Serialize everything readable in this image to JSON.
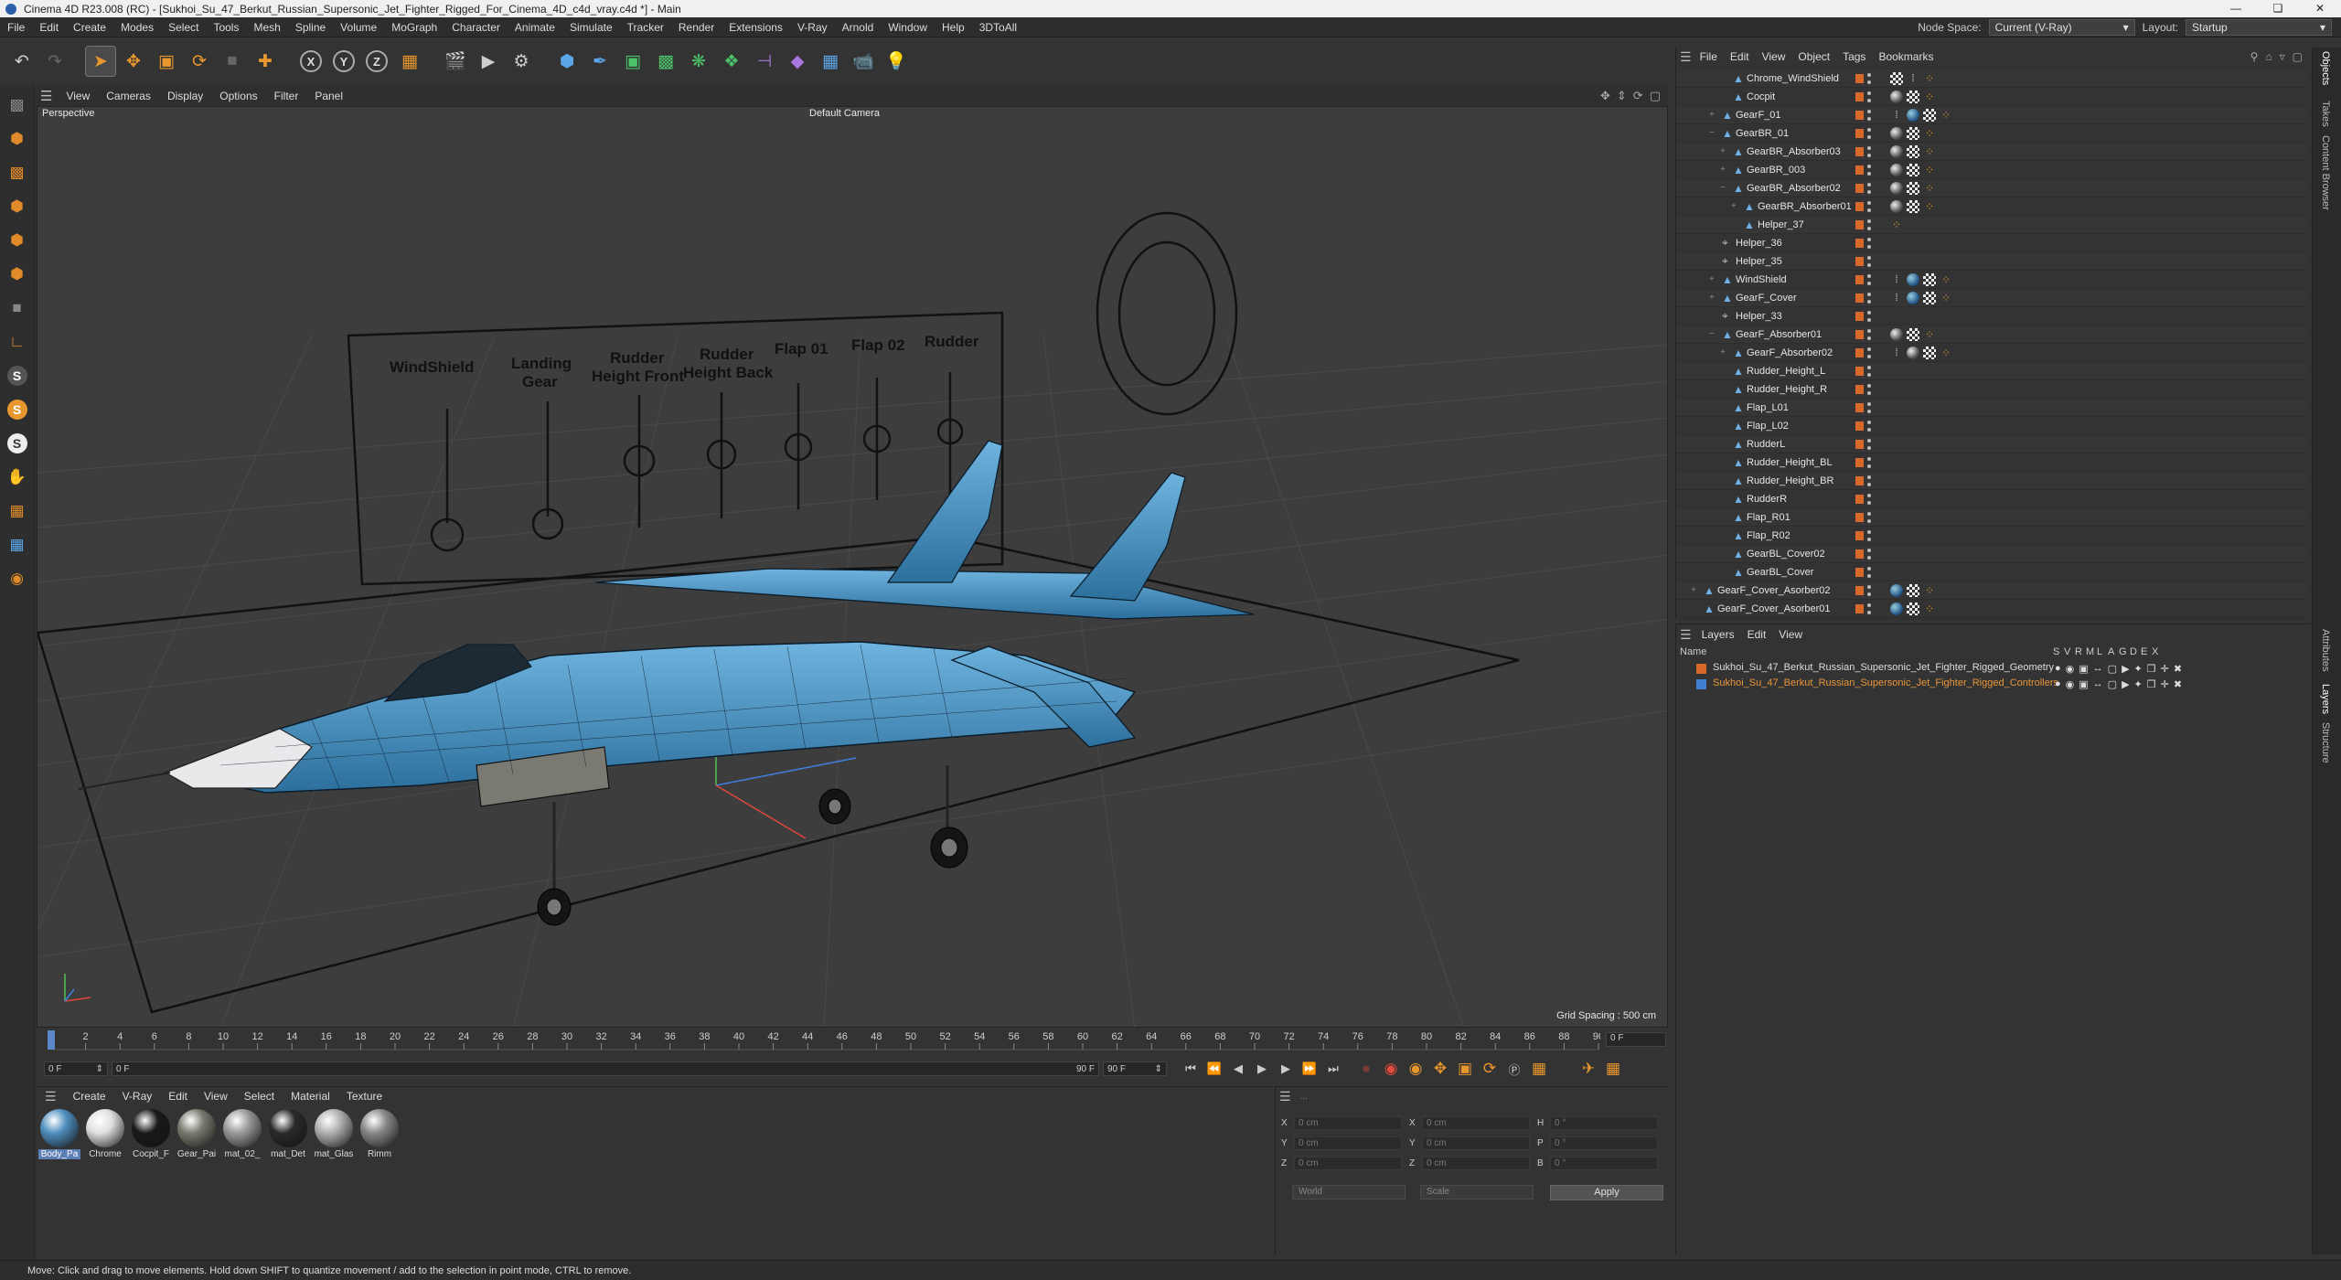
{
  "window": {
    "title": "Cinema 4D R23.008 (RC) - [Sukhoi_Su_47_Berkut_Russian_Supersonic_Jet_Fighter_Rigged_For_Cinema_4D_c4d_vray.c4d *] - Main",
    "minimize": "—",
    "maximize": "❏",
    "close": "✕"
  },
  "menubar": {
    "items": [
      "File",
      "Edit",
      "Create",
      "Modes",
      "Select",
      "Tools",
      "Mesh",
      "Spline",
      "Volume",
      "MoGraph",
      "Character",
      "Animate",
      "Simulate",
      "Tracker",
      "Render",
      "Extensions",
      "V-Ray",
      "Arnold",
      "Window",
      "Help",
      "3DToAll"
    ],
    "node_space_label": "Node Space:",
    "node_space_value": "Current (V-Ray)",
    "layout_label": "Layout:",
    "layout_value": "Startup"
  },
  "viewport": {
    "menu": [
      "View",
      "Cameras",
      "Display",
      "Options",
      "Filter",
      "Panel"
    ],
    "view_name": "Perspective",
    "camera": "Default Camera",
    "grid_spacing": "Grid Spacing : 500 cm",
    "sliders": [
      "WindShield",
      "Landing",
      "Gear",
      "Rudder",
      "Height Front",
      "Rudder",
      "Height Back",
      "Flap 01",
      "Flap 02",
      "Rudder"
    ]
  },
  "timeline": {
    "ticks": [
      "0",
      "2",
      "4",
      "6",
      "8",
      "10",
      "12",
      "14",
      "16",
      "18",
      "20",
      "22",
      "24",
      "26",
      "28",
      "30",
      "32",
      "34",
      "36",
      "38",
      "40",
      "42",
      "44",
      "46",
      "48",
      "50",
      "52",
      "54",
      "56",
      "58",
      "60",
      "62",
      "64",
      "66",
      "68",
      "70",
      "72",
      "74",
      "76",
      "78",
      "80",
      "82",
      "84",
      "86",
      "88",
      "90"
    ],
    "current_frame": "0 F",
    "start": "0 F",
    "min": "0 F",
    "end_left": "90 F",
    "end_right": "90 F"
  },
  "materials": {
    "menu": [
      "Create",
      "V-Ray",
      "Edit",
      "View",
      "Select",
      "Material",
      "Texture"
    ],
    "items": [
      {
        "label": "Body_Pa",
        "color": "#4f8fbf"
      },
      {
        "label": "Chrome",
        "color": "#e0e0e0"
      },
      {
        "label": "Cocpit_F",
        "color": "#1a1a1a"
      },
      {
        "label": "Gear_Pai",
        "color": "#7a7a70"
      },
      {
        "label": "mat_02_",
        "color": "#9a9a9a"
      },
      {
        "label": "mat_Det",
        "color": "#2a2a2a"
      },
      {
        "label": "mat_Glas",
        "color": "#b0b0b0"
      },
      {
        "label": "Rimm",
        "color": "#888888"
      }
    ]
  },
  "attributes": {
    "head": "...",
    "x_label": "X",
    "y_label": "Y",
    "z_label": "Z",
    "h_label": "H",
    "p_label": "P",
    "b_label": "B",
    "pos_value": "0 cm",
    "rot_value": "0 °",
    "coord_mode": "World",
    "scale_mode": "Scale",
    "apply": "Apply"
  },
  "objects": {
    "menu": [
      "File",
      "Edit",
      "View",
      "Object",
      "Tags",
      "Bookmarks"
    ],
    "rows": [
      {
        "name": "Chrome_WindShield",
        "icon": "mesh"
      },
      {
        "name": "Cocpit",
        "icon": "mesh"
      },
      {
        "name": "GearF_01",
        "icon": "mesh"
      },
      {
        "name": "GearBR_01",
        "icon": "mesh"
      },
      {
        "name": "GearBR_Absorber03",
        "icon": "mesh"
      },
      {
        "name": "GearBR_003",
        "icon": "mesh"
      },
      {
        "name": "GearBR_Absorber02",
        "icon": "mesh"
      },
      {
        "name": "GearBR_Absorber01",
        "icon": "mesh"
      },
      {
        "name": "Helper_37",
        "icon": "mesh"
      },
      {
        "name": "Helper_36",
        "icon": "null"
      },
      {
        "name": "Helper_35",
        "icon": "null"
      },
      {
        "name": "WindShield",
        "icon": "mesh"
      },
      {
        "name": "GearF_Cover",
        "icon": "mesh"
      },
      {
        "name": "Helper_33",
        "icon": "null"
      },
      {
        "name": "GearF_Absorber01",
        "icon": "mesh"
      },
      {
        "name": "GearF_Absorber02",
        "icon": "mesh"
      },
      {
        "name": "Rudder_Height_L",
        "icon": "mesh"
      },
      {
        "name": "Rudder_Height_R",
        "icon": "mesh"
      },
      {
        "name": "Flap_L01",
        "icon": "mesh"
      },
      {
        "name": "Flap_L02",
        "icon": "mesh"
      },
      {
        "name": "RudderL",
        "icon": "mesh"
      },
      {
        "name": "Rudder_Height_BL",
        "icon": "mesh"
      },
      {
        "name": "Rudder_Height_BR",
        "icon": "mesh"
      },
      {
        "name": "RudderR",
        "icon": "mesh"
      },
      {
        "name": "Flap_R01",
        "icon": "mesh"
      },
      {
        "name": "Flap_R02",
        "icon": "mesh"
      },
      {
        "name": "GearBL_Cover02",
        "icon": "mesh"
      },
      {
        "name": "GearBL_Cover",
        "icon": "mesh"
      },
      {
        "name": "GearF_Cover_Asorber02",
        "icon": "mesh"
      },
      {
        "name": "GearF_Cover_Asorber01",
        "icon": "mesh"
      }
    ]
  },
  "layers": {
    "menu": [
      "Layers",
      "Edit",
      "View"
    ],
    "col_name": "Name",
    "flags": [
      "S",
      "V",
      "R",
      "M",
      "L",
      "A",
      "G",
      "D",
      "E",
      "X"
    ],
    "rows": [
      {
        "name": "Sukhoi_Su_47_Berkut_Russian_Supersonic_Jet_Fighter_Rigged_Geometry",
        "color": "#d9682b",
        "text_color": "#dcdcdc"
      },
      {
        "name": "Sukhoi_Su_47_Berkut_Russian_Supersonic_Jet_Fighter_Rigged_Controllers",
        "color": "#3f7fd0",
        "text_color": "#e8963a"
      }
    ]
  },
  "right_tabs": [
    "Objects",
    "Takes",
    "Content Browser",
    "Attributes",
    "Layers",
    "Structure"
  ],
  "status": "Move: Click and drag to move elements. Hold down SHIFT to quantize movement / add to the selection in point mode, CTRL to remove."
}
